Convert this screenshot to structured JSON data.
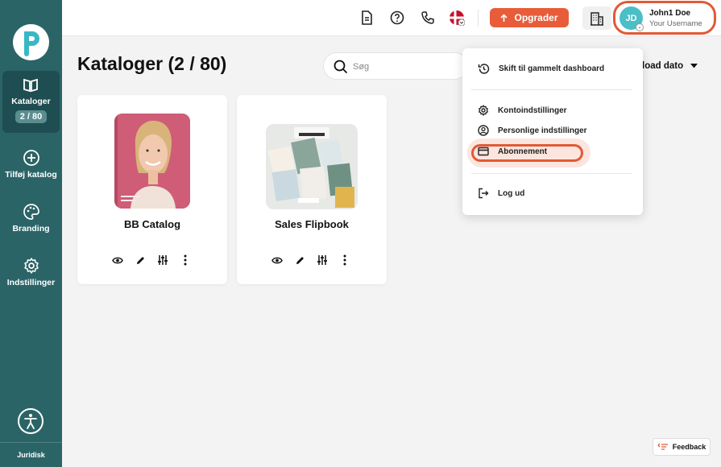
{
  "sidebar": {
    "items": [
      {
        "label": "Kataloger",
        "count": "2 / 80"
      },
      {
        "label": "Tilføj katalog"
      },
      {
        "label": "Branding"
      },
      {
        "label": "Indstillinger"
      }
    ],
    "legal": "Juridisk"
  },
  "topbar": {
    "upgrade_label": "Opgrader",
    "user": {
      "initials": "JD",
      "name": "John1 Doe",
      "username": "Your Username"
    }
  },
  "main": {
    "title": "Kataloger (2 / 80)",
    "search_placeholder": "Søg",
    "sort_label": "load dato"
  },
  "catalogs": [
    {
      "title": "BB Catalog"
    },
    {
      "title": "Sales Flipbook"
    }
  ],
  "dropdown": {
    "items": [
      {
        "label": "Skift til gammelt dashboard"
      },
      {
        "label": "Kontoindstillinger"
      },
      {
        "label": "Personlige indstillinger"
      },
      {
        "label": "Abonnement"
      },
      {
        "label": "Log ud"
      }
    ]
  },
  "feedback_label": "Feedback",
  "colors": {
    "sidebar": "#2b6467",
    "accent": "#e85c3a",
    "avatar": "#4bbec6"
  }
}
